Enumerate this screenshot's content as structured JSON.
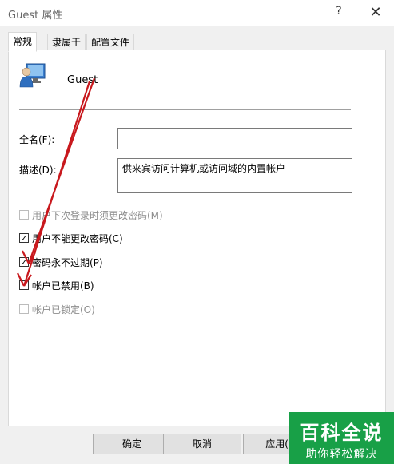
{
  "window": {
    "title": "Guest 属性",
    "help": "?",
    "close": "✕"
  },
  "tabs": [
    {
      "label": "常规",
      "active": true
    },
    {
      "label": "隶属于",
      "active": false
    },
    {
      "label": "配置文件",
      "active": false
    }
  ],
  "user": {
    "name": "Guest",
    "icon": "user-monitor-icon"
  },
  "fields": {
    "fullname_label": "全名(F):",
    "fullname_value": "",
    "description_label": "描述(D):",
    "description_value": "供来宾访问计算机或访问域的内置帐户"
  },
  "checkboxes": [
    {
      "label": "用户下次登录时须更改密码(M)",
      "checked": false,
      "disabled": true
    },
    {
      "label": "用户不能更改密码(C)",
      "checked": true,
      "disabled": false
    },
    {
      "label": "密码永不过期(P)",
      "checked": true,
      "disabled": false
    },
    {
      "label": "帐户已禁用(B)",
      "checked": false,
      "disabled": false
    },
    {
      "label": "帐户已锁定(O)",
      "checked": false,
      "disabled": true
    }
  ],
  "buttons": {
    "ok": "确定",
    "cancel": "取消",
    "apply": "应用(A)"
  },
  "annotation_color": "#c8181d",
  "watermark": {
    "title": "百科全说",
    "subtitle": "助你轻松解决",
    "color": "#18a047"
  }
}
